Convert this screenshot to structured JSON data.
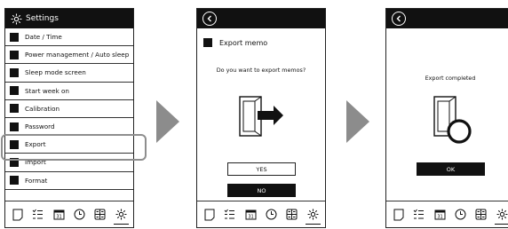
{
  "settings": {
    "title": "Settings",
    "items": [
      "Date / Time",
      "Power management / Auto sleep",
      "Sleep mode screen",
      "Start week on",
      "Calibration",
      "Password",
      "Export",
      "Import",
      "Format"
    ],
    "highlighted_item": "Export"
  },
  "export_dialog": {
    "title": "Export memo",
    "question": "Do you want to export memos?",
    "yes_label": "YES",
    "no_label": "NO"
  },
  "export_done": {
    "message": "Export completed",
    "ok_label": "OK"
  },
  "toolbar_icons": [
    "memo-icon",
    "list-icon",
    "calendar-icon",
    "clock-icon",
    "grid-icon",
    "gear-icon"
  ],
  "calendar_icon_day": "31",
  "colors": {
    "bar": "#111111",
    "arrow": "#8c8c8c",
    "highlight": "#8e8e8e"
  }
}
